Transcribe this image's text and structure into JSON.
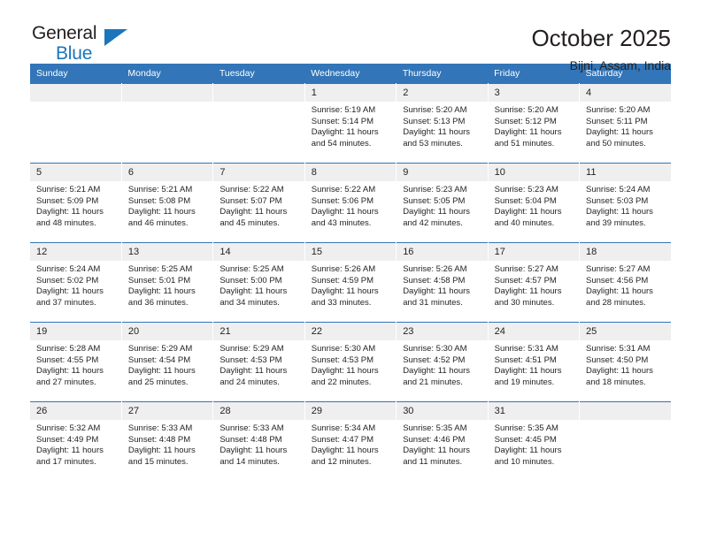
{
  "brand": {
    "name_part1": "General",
    "name_part2": "Blue",
    "triangle_color": "#1b75bb"
  },
  "header": {
    "title": "October 2025",
    "subtitle": "Bijni, Assam, India"
  },
  "theme": {
    "header_row_bg": "#3275b8",
    "daynum_bg": "#efefef",
    "text": "#231f20",
    "page_bg": "#ffffff"
  },
  "weekday_headers": [
    "Sunday",
    "Monday",
    "Tuesday",
    "Wednesday",
    "Thursday",
    "Friday",
    "Saturday"
  ],
  "weeks": [
    [
      {
        "day": "",
        "sunrise": "",
        "sunset": "",
        "daylight_line1": "",
        "daylight_line2": ""
      },
      {
        "day": "",
        "sunrise": "",
        "sunset": "",
        "daylight_line1": "",
        "daylight_line2": ""
      },
      {
        "day": "",
        "sunrise": "",
        "sunset": "",
        "daylight_line1": "",
        "daylight_line2": ""
      },
      {
        "day": "1",
        "sunrise": "Sunrise: 5:19 AM",
        "sunset": "Sunset: 5:14 PM",
        "daylight_line1": "Daylight: 11 hours",
        "daylight_line2": "and 54 minutes."
      },
      {
        "day": "2",
        "sunrise": "Sunrise: 5:20 AM",
        "sunset": "Sunset: 5:13 PM",
        "daylight_line1": "Daylight: 11 hours",
        "daylight_line2": "and 53 minutes."
      },
      {
        "day": "3",
        "sunrise": "Sunrise: 5:20 AM",
        "sunset": "Sunset: 5:12 PM",
        "daylight_line1": "Daylight: 11 hours",
        "daylight_line2": "and 51 minutes."
      },
      {
        "day": "4",
        "sunrise": "Sunrise: 5:20 AM",
        "sunset": "Sunset: 5:11 PM",
        "daylight_line1": "Daylight: 11 hours",
        "daylight_line2": "and 50 minutes."
      }
    ],
    [
      {
        "day": "5",
        "sunrise": "Sunrise: 5:21 AM",
        "sunset": "Sunset: 5:09 PM",
        "daylight_line1": "Daylight: 11 hours",
        "daylight_line2": "and 48 minutes."
      },
      {
        "day": "6",
        "sunrise": "Sunrise: 5:21 AM",
        "sunset": "Sunset: 5:08 PM",
        "daylight_line1": "Daylight: 11 hours",
        "daylight_line2": "and 46 minutes."
      },
      {
        "day": "7",
        "sunrise": "Sunrise: 5:22 AM",
        "sunset": "Sunset: 5:07 PM",
        "daylight_line1": "Daylight: 11 hours",
        "daylight_line2": "and 45 minutes."
      },
      {
        "day": "8",
        "sunrise": "Sunrise: 5:22 AM",
        "sunset": "Sunset: 5:06 PM",
        "daylight_line1": "Daylight: 11 hours",
        "daylight_line2": "and 43 minutes."
      },
      {
        "day": "9",
        "sunrise": "Sunrise: 5:23 AM",
        "sunset": "Sunset: 5:05 PM",
        "daylight_line1": "Daylight: 11 hours",
        "daylight_line2": "and 42 minutes."
      },
      {
        "day": "10",
        "sunrise": "Sunrise: 5:23 AM",
        "sunset": "Sunset: 5:04 PM",
        "daylight_line1": "Daylight: 11 hours",
        "daylight_line2": "and 40 minutes."
      },
      {
        "day": "11",
        "sunrise": "Sunrise: 5:24 AM",
        "sunset": "Sunset: 5:03 PM",
        "daylight_line1": "Daylight: 11 hours",
        "daylight_line2": "and 39 minutes."
      }
    ],
    [
      {
        "day": "12",
        "sunrise": "Sunrise: 5:24 AM",
        "sunset": "Sunset: 5:02 PM",
        "daylight_line1": "Daylight: 11 hours",
        "daylight_line2": "and 37 minutes."
      },
      {
        "day": "13",
        "sunrise": "Sunrise: 5:25 AM",
        "sunset": "Sunset: 5:01 PM",
        "daylight_line1": "Daylight: 11 hours",
        "daylight_line2": "and 36 minutes."
      },
      {
        "day": "14",
        "sunrise": "Sunrise: 5:25 AM",
        "sunset": "Sunset: 5:00 PM",
        "daylight_line1": "Daylight: 11 hours",
        "daylight_line2": "and 34 minutes."
      },
      {
        "day": "15",
        "sunrise": "Sunrise: 5:26 AM",
        "sunset": "Sunset: 4:59 PM",
        "daylight_line1": "Daylight: 11 hours",
        "daylight_line2": "and 33 minutes."
      },
      {
        "day": "16",
        "sunrise": "Sunrise: 5:26 AM",
        "sunset": "Sunset: 4:58 PM",
        "daylight_line1": "Daylight: 11 hours",
        "daylight_line2": "and 31 minutes."
      },
      {
        "day": "17",
        "sunrise": "Sunrise: 5:27 AM",
        "sunset": "Sunset: 4:57 PM",
        "daylight_line1": "Daylight: 11 hours",
        "daylight_line2": "and 30 minutes."
      },
      {
        "day": "18",
        "sunrise": "Sunrise: 5:27 AM",
        "sunset": "Sunset: 4:56 PM",
        "daylight_line1": "Daylight: 11 hours",
        "daylight_line2": "and 28 minutes."
      }
    ],
    [
      {
        "day": "19",
        "sunrise": "Sunrise: 5:28 AM",
        "sunset": "Sunset: 4:55 PM",
        "daylight_line1": "Daylight: 11 hours",
        "daylight_line2": "and 27 minutes."
      },
      {
        "day": "20",
        "sunrise": "Sunrise: 5:29 AM",
        "sunset": "Sunset: 4:54 PM",
        "daylight_line1": "Daylight: 11 hours",
        "daylight_line2": "and 25 minutes."
      },
      {
        "day": "21",
        "sunrise": "Sunrise: 5:29 AM",
        "sunset": "Sunset: 4:53 PM",
        "daylight_line1": "Daylight: 11 hours",
        "daylight_line2": "and 24 minutes."
      },
      {
        "day": "22",
        "sunrise": "Sunrise: 5:30 AM",
        "sunset": "Sunset: 4:53 PM",
        "daylight_line1": "Daylight: 11 hours",
        "daylight_line2": "and 22 minutes."
      },
      {
        "day": "23",
        "sunrise": "Sunrise: 5:30 AM",
        "sunset": "Sunset: 4:52 PM",
        "daylight_line1": "Daylight: 11 hours",
        "daylight_line2": "and 21 minutes."
      },
      {
        "day": "24",
        "sunrise": "Sunrise: 5:31 AM",
        "sunset": "Sunset: 4:51 PM",
        "daylight_line1": "Daylight: 11 hours",
        "daylight_line2": "and 19 minutes."
      },
      {
        "day": "25",
        "sunrise": "Sunrise: 5:31 AM",
        "sunset": "Sunset: 4:50 PM",
        "daylight_line1": "Daylight: 11 hours",
        "daylight_line2": "and 18 minutes."
      }
    ],
    [
      {
        "day": "26",
        "sunrise": "Sunrise: 5:32 AM",
        "sunset": "Sunset: 4:49 PM",
        "daylight_line1": "Daylight: 11 hours",
        "daylight_line2": "and 17 minutes."
      },
      {
        "day": "27",
        "sunrise": "Sunrise: 5:33 AM",
        "sunset": "Sunset: 4:48 PM",
        "daylight_line1": "Daylight: 11 hours",
        "daylight_line2": "and 15 minutes."
      },
      {
        "day": "28",
        "sunrise": "Sunrise: 5:33 AM",
        "sunset": "Sunset: 4:48 PM",
        "daylight_line1": "Daylight: 11 hours",
        "daylight_line2": "and 14 minutes."
      },
      {
        "day": "29",
        "sunrise": "Sunrise: 5:34 AM",
        "sunset": "Sunset: 4:47 PM",
        "daylight_line1": "Daylight: 11 hours",
        "daylight_line2": "and 12 minutes."
      },
      {
        "day": "30",
        "sunrise": "Sunrise: 5:35 AM",
        "sunset": "Sunset: 4:46 PM",
        "daylight_line1": "Daylight: 11 hours",
        "daylight_line2": "and 11 minutes."
      },
      {
        "day": "31",
        "sunrise": "Sunrise: 5:35 AM",
        "sunset": "Sunset: 4:45 PM",
        "daylight_line1": "Daylight: 11 hours",
        "daylight_line2": "and 10 minutes."
      },
      {
        "day": "",
        "sunrise": "",
        "sunset": "",
        "daylight_line1": "",
        "daylight_line2": ""
      }
    ]
  ]
}
